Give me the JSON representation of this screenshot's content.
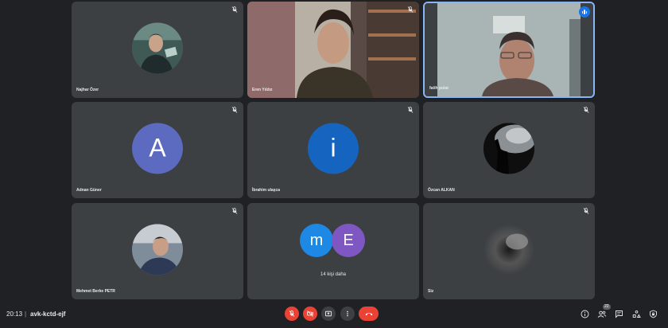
{
  "participants": [
    {
      "name": "Najhar Özer"
    },
    {
      "name": "Eren Yıldız"
    },
    {
      "name": "fatih polat"
    },
    {
      "name": "Adnan Güner",
      "initial": "A",
      "color": "#5c6bc0"
    },
    {
      "name": "İbrahim ulaşca",
      "initial": "i",
      "color": "#1565c0"
    },
    {
      "name": "Özcan ALKAN"
    },
    {
      "name": "Mehmet Berke PETR"
    },
    {
      "name": "Siz"
    }
  ],
  "more_tile": {
    "avatars": [
      {
        "initial": "m",
        "color": "#1e88e5"
      },
      {
        "initial": "E",
        "color": "#7e57c2"
      }
    ],
    "label": "14 kişi daha"
  },
  "bottom_bar": {
    "time": "20:13",
    "separator": "|",
    "meeting_code": "avk-kctd-ejf",
    "people_count": "22"
  }
}
